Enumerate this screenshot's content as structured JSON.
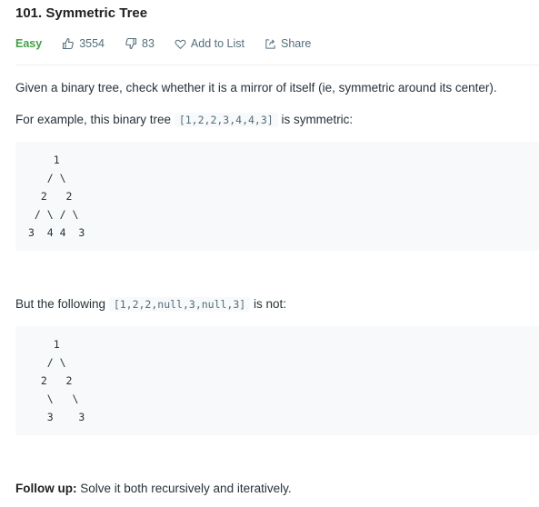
{
  "problem": {
    "title": "101. Symmetric Tree",
    "difficulty": "Easy",
    "likes": "3554",
    "dislikes": "83",
    "add_to_list_label": "Add to List",
    "share_label": "Share"
  },
  "description": {
    "intro": "Given a binary tree, check whether it is a mirror of itself (ie, symmetric around its center).",
    "example_prefix": "For example, this binary tree ",
    "example_code": "[1,2,2,3,4,4,3]",
    "example_suffix": " is symmetric:",
    "tree_symmetric": "    1\n   / \\\n  2   2\n / \\ / \\\n3  4 4  3",
    "counter_prefix": "But the following ",
    "counter_code": "[1,2,2,null,3,null,3]",
    "counter_suffix": " is not:",
    "tree_not_symmetric": "    1\n   / \\\n  2   2\n   \\   \\\n   3    3",
    "followup_label": "Follow up:",
    "followup_text": " Solve it both recursively and iteratively."
  },
  "colors": {
    "easy": "#43a047",
    "meta_text": "#546e7a",
    "code_bg": "#f7f9fa"
  }
}
